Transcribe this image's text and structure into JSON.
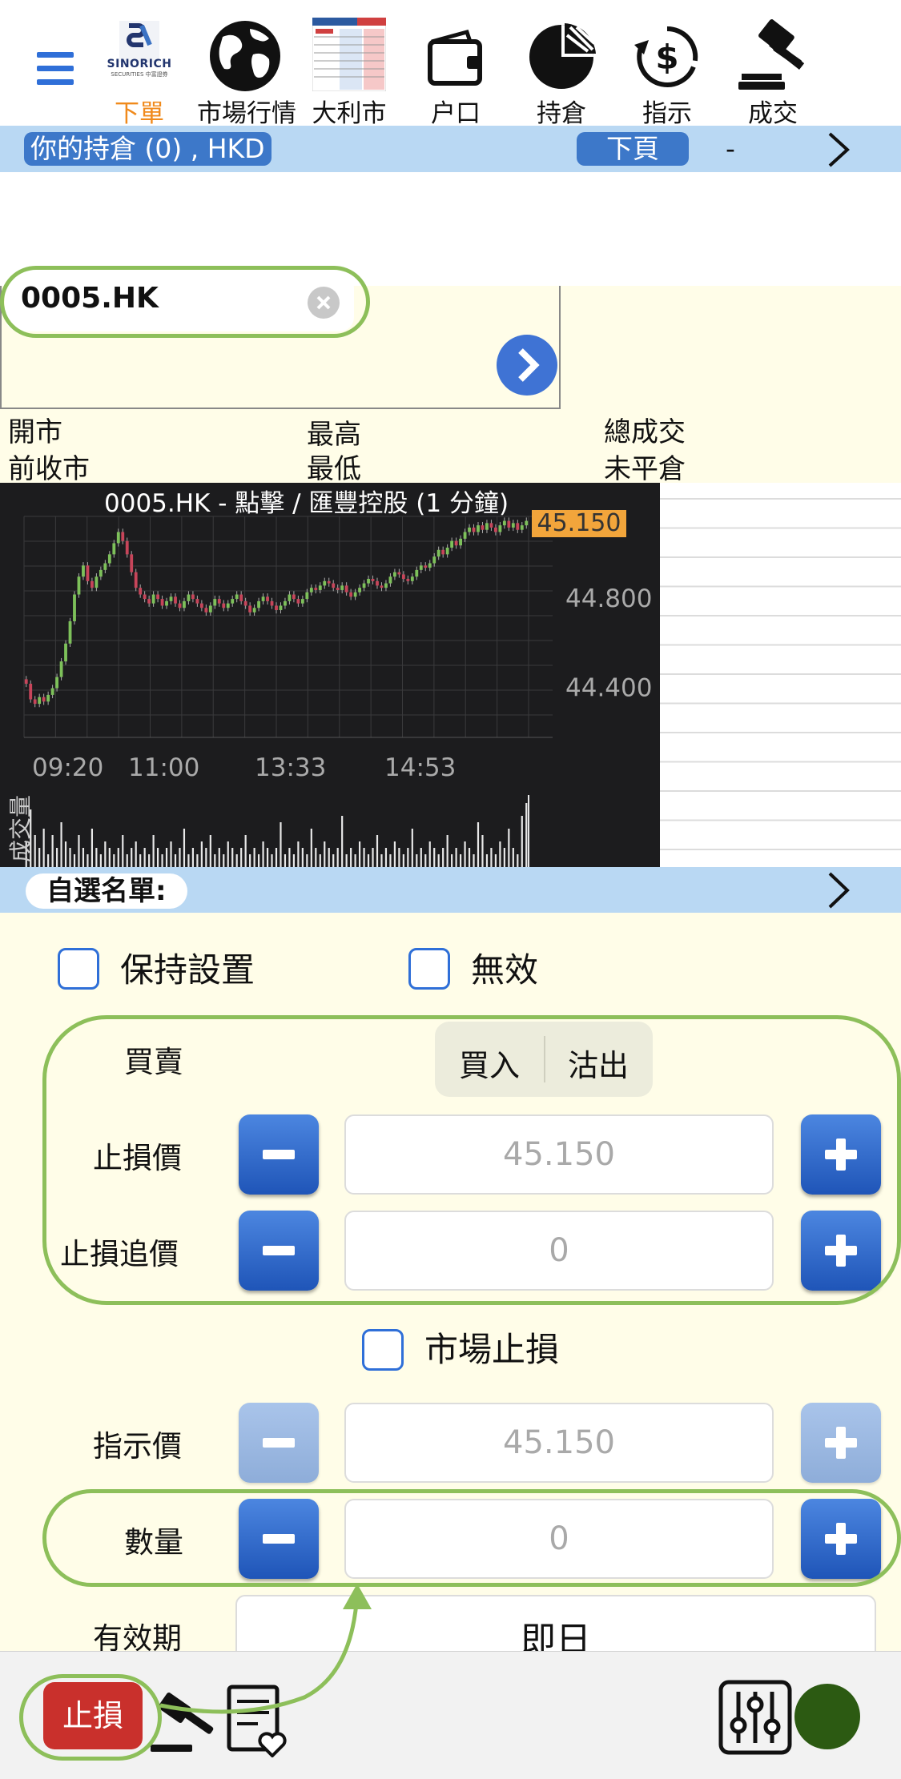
{
  "nav": {
    "items": [
      {
        "label": "下單",
        "icon": "sinorich-logo"
      },
      {
        "label": "市場行情",
        "icon": "globe-icon"
      },
      {
        "label": "大利市",
        "icon": "quote-table-icon"
      },
      {
        "label": "户口",
        "icon": "wallet-icon"
      },
      {
        "label": "持倉",
        "icon": "pie-chart-icon"
      },
      {
        "label": "指示",
        "icon": "dollar-cycle-icon"
      },
      {
        "label": "成交",
        "icon": "gavel-icon"
      }
    ],
    "logo_text": "SINORICH",
    "logo_sub": "SECURITIES 中富證券"
  },
  "holdings_bar": {
    "label": "你的持倉 (0) , HKD",
    "next_page": "下頁",
    "dash": "-"
  },
  "search": {
    "value": "0005.HK"
  },
  "quote_labels": {
    "open": "開市",
    "prev_close": "前收市",
    "high": "最高",
    "low": "最低",
    "total_volume": "總成交",
    "open_interest": "未平倉"
  },
  "chart": {
    "title": "0005.HK - 點擊 / 匯豐控股 (1 分鐘)",
    "current_price": "45.150",
    "volume_label": "成交量"
  },
  "chart_data": {
    "type": "candlestick",
    "title": "0005.HK - 點擊 / 匯豐控股 (1 分鐘)",
    "x_ticks": [
      "09:20",
      "11:00",
      "13:33",
      "14:53"
    ],
    "y_ticks": [
      44.8,
      44.4
    ],
    "y_tick_labels": [
      "44.800",
      "44.400"
    ],
    "ylim": [
      44.28,
      45.17
    ],
    "last_price": 45.15,
    "closes": [
      44.42,
      44.35,
      44.33,
      44.36,
      44.34,
      44.37,
      44.4,
      44.45,
      44.52,
      44.6,
      44.7,
      44.82,
      44.9,
      44.95,
      44.88,
      44.85,
      44.9,
      44.93,
      44.96,
      45.0,
      45.05,
      45.1,
      45.06,
      45.0,
      44.92,
      44.85,
      44.82,
      44.8,
      44.78,
      44.82,
      44.8,
      44.77,
      44.79,
      44.81,
      44.78,
      44.76,
      44.79,
      44.82,
      44.8,
      44.78,
      44.76,
      44.74,
      44.77,
      44.8,
      44.78,
      44.76,
      44.78,
      44.8,
      44.82,
      44.79,
      44.77,
      44.74,
      44.76,
      44.79,
      44.81,
      44.79,
      44.77,
      44.75,
      44.77,
      44.79,
      44.82,
      44.8,
      44.78,
      44.8,
      44.83,
      44.85,
      44.84,
      44.86,
      44.88,
      44.87,
      44.85,
      44.84,
      44.86,
      44.83,
      44.81,
      44.83,
      44.85,
      44.87,
      44.89,
      44.88,
      44.86,
      44.85,
      44.87,
      44.9,
      44.92,
      44.91,
      44.89,
      44.88,
      44.9,
      44.93,
      44.95,
      44.94,
      44.96,
      44.99,
      45.02,
      45.0,
      45.03,
      45.06,
      45.04,
      45.07,
      45.1,
      45.12,
      45.1,
      45.13,
      45.11,
      45.14,
      45.12,
      45.1,
      45.13,
      45.15,
      45.12,
      45.14,
      45.11,
      45.13,
      45.15
    ],
    "volumes": [
      0.4,
      0.9,
      0.5,
      0.3,
      0.6,
      0.2,
      0.5,
      0.3,
      0.7,
      0.4,
      0.3,
      0.2,
      0.5,
      0.3,
      0.2,
      0.6,
      0.3,
      0.2,
      0.4,
      0.3,
      0.2,
      0.3,
      0.5,
      0.2,
      0.3,
      0.4,
      0.2,
      0.3,
      0.2,
      0.5,
      0.3,
      0.2,
      0.3,
      0.4,
      0.2,
      0.3,
      0.6,
      0.2,
      0.3,
      0.2,
      0.4,
      0.3,
      0.5,
      0.2,
      0.3,
      0.2,
      0.4,
      0.3,
      0.2,
      0.3,
      0.5,
      0.2,
      0.3,
      0.2,
      0.4,
      0.3,
      0.2,
      0.3,
      0.7,
      0.2,
      0.3,
      0.2,
      0.4,
      0.3,
      0.2,
      0.6,
      0.3,
      0.2,
      0.4,
      0.3,
      0.2,
      0.3,
      0.8,
      0.2,
      0.3,
      0.2,
      0.4,
      0.3,
      0.2,
      0.3,
      0.5,
      0.2,
      0.3,
      0.2,
      0.4,
      0.3,
      0.2,
      0.3,
      0.6,
      0.2,
      0.3,
      0.2,
      0.4,
      0.3,
      0.2,
      0.3,
      0.5,
      0.2,
      0.3,
      0.2,
      0.4,
      0.3,
      0.2,
      0.7,
      0.5,
      0.2,
      0.3,
      0.2,
      0.4,
      0.3,
      0.6,
      0.3,
      0.2,
      0.8,
      1.0
    ]
  },
  "watchlist": {
    "label": "自選名單:"
  },
  "options": {
    "keep_settings": "保持設置",
    "invalid": "無效",
    "market_stop": "市場止損"
  },
  "form": {
    "side_label": "買賣",
    "buy": "買入",
    "sell": "沽出",
    "stop_price_label": "止損價",
    "stop_price_value": "45.150",
    "trail_label": "止損追價",
    "trail_value": "0",
    "order_price_label": "指示價",
    "order_price_value": "45.150",
    "qty_label": "數量",
    "qty_value": "0",
    "validity_label": "有效期",
    "validity_value": "即日"
  },
  "bottom": {
    "stop_button": "止損"
  },
  "colors": {
    "accent_orange": "#f08a1c",
    "blue_bar": "#b9d8f3",
    "cream": "#fffde8",
    "green_annotation": "#8dbf5a",
    "red_button": "#c9302c",
    "status_dot": "#2c5a12"
  }
}
